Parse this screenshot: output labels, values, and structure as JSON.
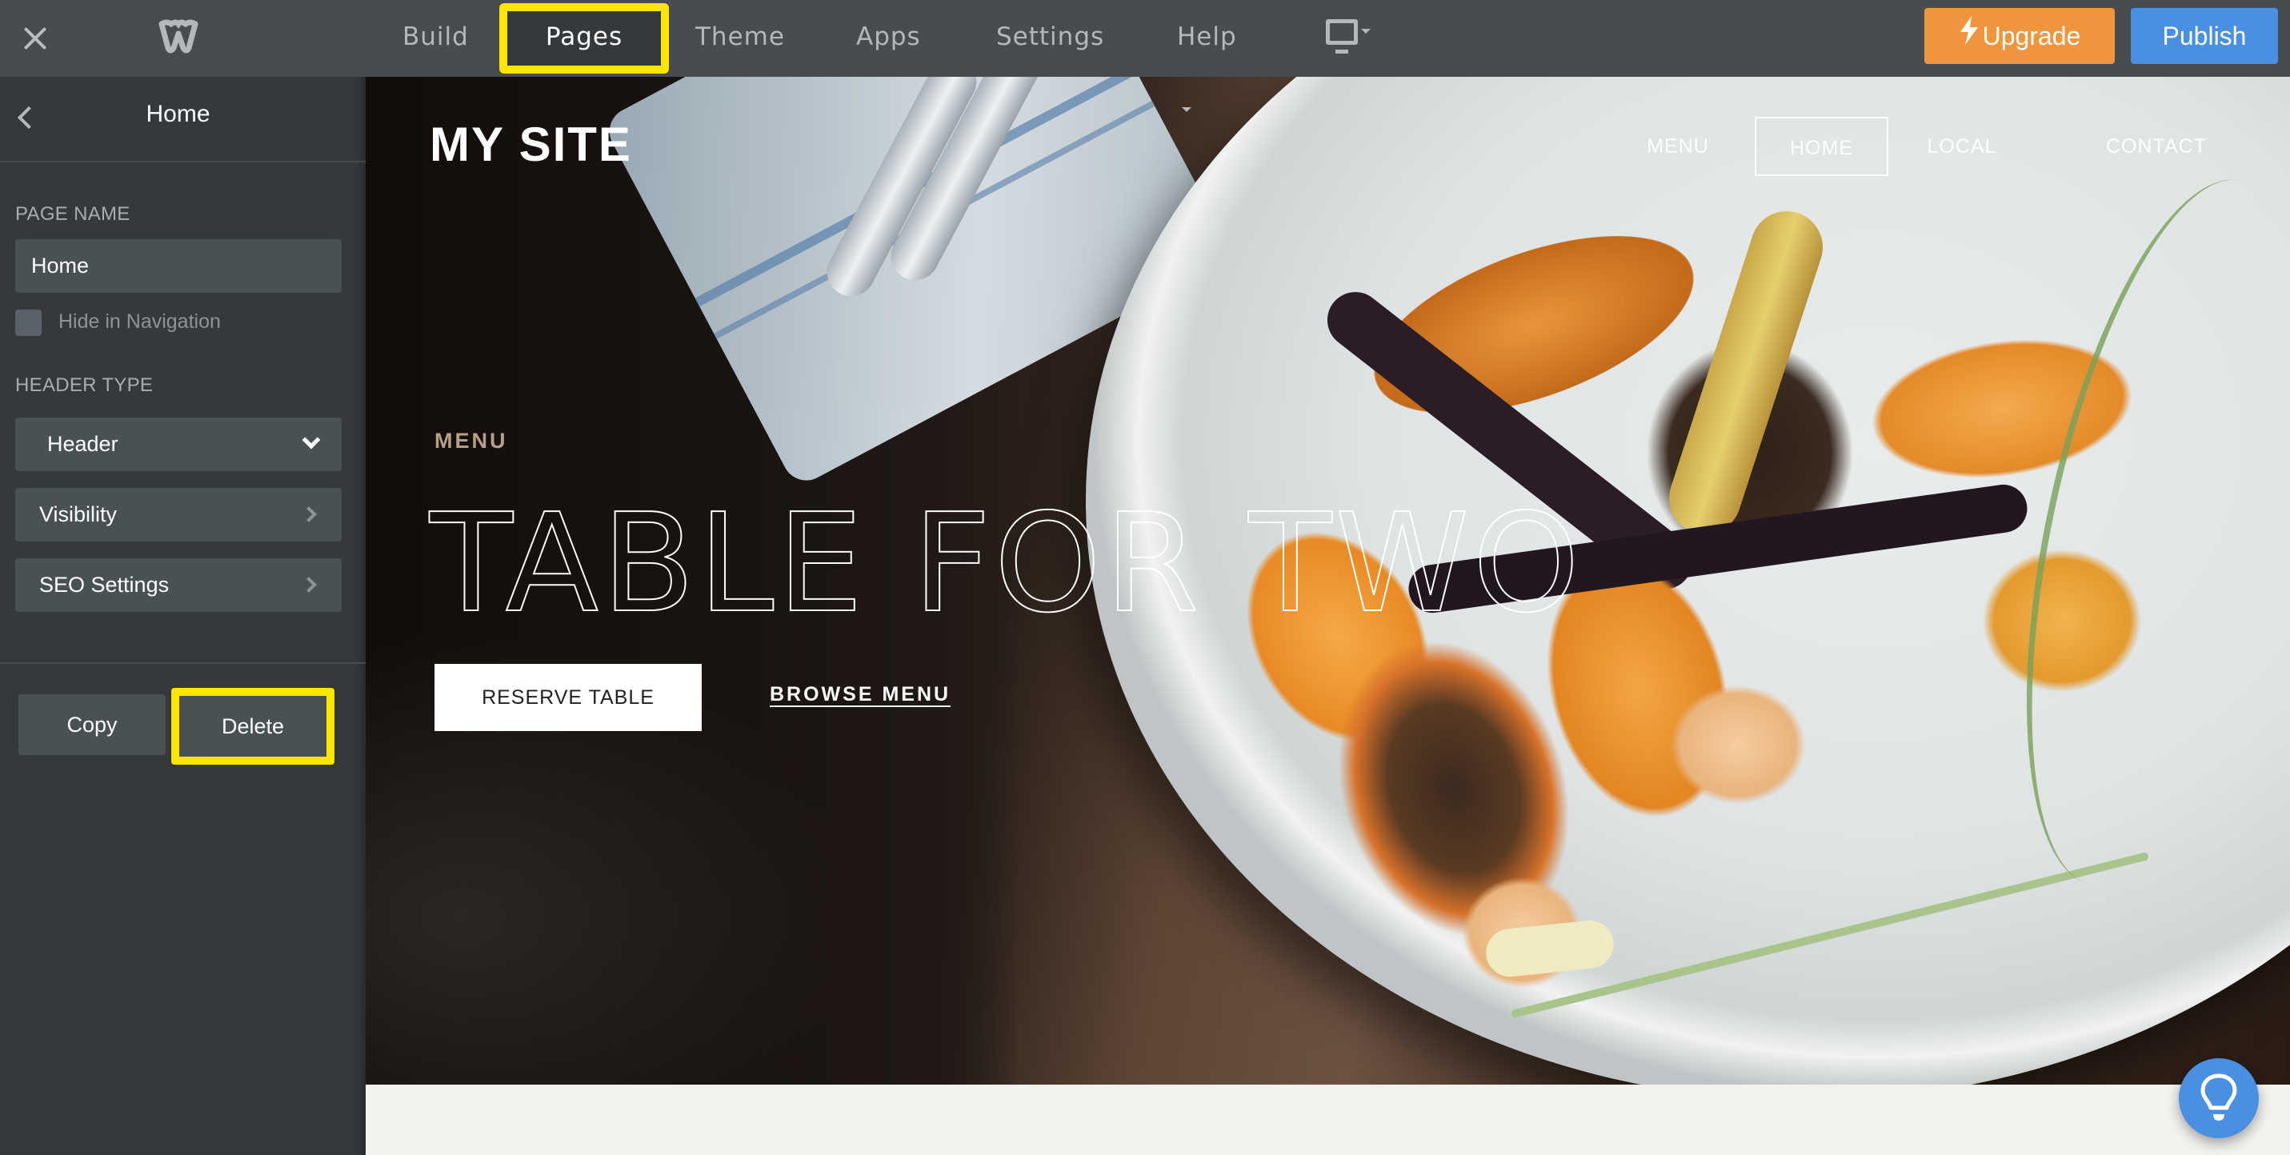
{
  "topbar": {
    "close_icon": "close-icon",
    "logo_icon": "weebly-logo",
    "nav": [
      {
        "label": "Build",
        "active": false
      },
      {
        "label": "Pages",
        "active": true
      },
      {
        "label": "Theme",
        "active": false
      },
      {
        "label": "Apps",
        "active": false
      },
      {
        "label": "Settings",
        "active": false
      },
      {
        "label": "Help",
        "active": false,
        "dropdown": true
      }
    ],
    "device_icon": "desktop-monitor-icon",
    "upgrade_label": "Upgrade",
    "publish_label": "Publish",
    "colors": {
      "upgrade": "#f0953c",
      "publish": "#4a90e2",
      "highlight": "#ffe600"
    }
  },
  "sidebar": {
    "title": "Home",
    "page_name_label": "PAGE NAME",
    "page_name_value": "Home",
    "hide_in_nav_label": "Hide in Navigation",
    "hide_in_nav_checked": false,
    "header_type_label": "HEADER TYPE",
    "header_type_value": "Header",
    "visibility_label": "Visibility",
    "seo_label": "SEO Settings",
    "copy_label": "Copy",
    "delete_label": "Delete"
  },
  "site": {
    "title": "MY SITE",
    "nav": [
      {
        "label": "MENU",
        "active": false
      },
      {
        "label": "HOME",
        "active": true
      },
      {
        "label": "LOCAL",
        "active": false
      },
      {
        "label": "CONTACT",
        "active": false
      }
    ],
    "eyebrow": "MENU",
    "headline": "TABLE FOR TWO",
    "primary_button": "RESERVE TABLE",
    "secondary_link": "BROWSE MENU"
  },
  "help_fab_icon": "lightbulb-icon"
}
